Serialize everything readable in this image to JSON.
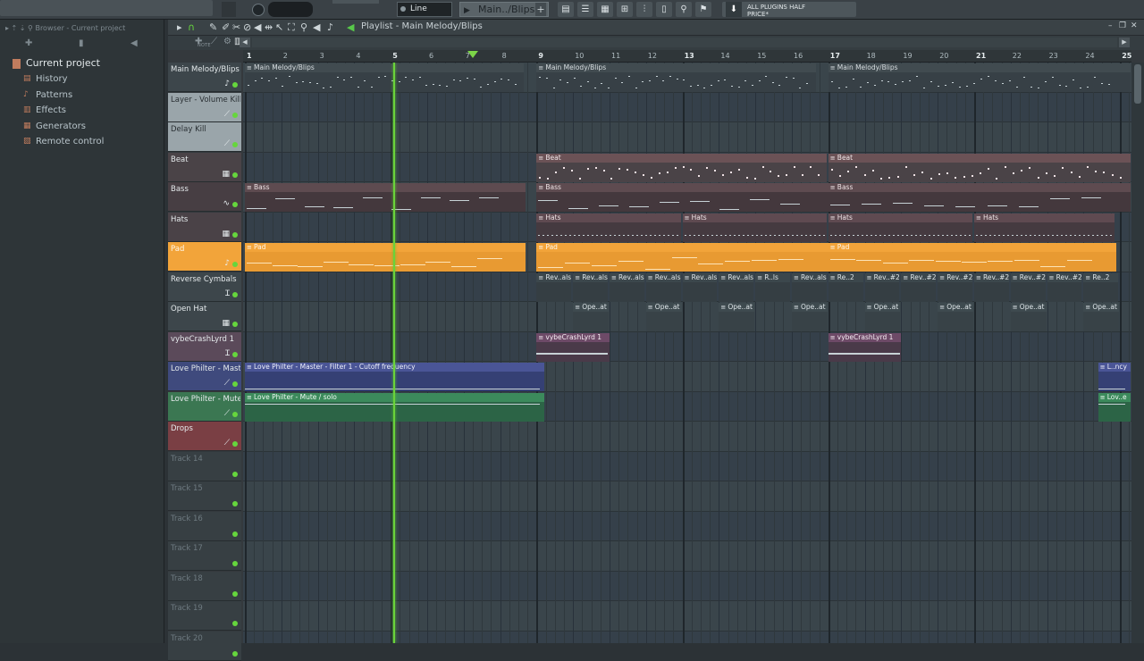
{
  "toolbar": {
    "line_mode": "Line",
    "pattern_name": "Main../Blips",
    "news_text_1": "ALL PLUGINS HALF",
    "news_text_2": "PRICE*"
  },
  "browser": {
    "title": "Browser - Current project",
    "root": "Current project",
    "items": [
      "History",
      "Patterns",
      "Effects",
      "Generators",
      "Remote control"
    ]
  },
  "playlist": {
    "title": "Playlist - Main Melody/Blips",
    "tools_label": "NOTE",
    "bars": [
      "1",
      "2",
      "3",
      "4",
      "5",
      "6",
      "7",
      "8",
      "9",
      "10",
      "11",
      "12",
      "13",
      "14",
      "15",
      "16",
      "17",
      "18",
      "19",
      "20",
      "21",
      "22",
      "23",
      "24",
      "25"
    ],
    "tracks": [
      {
        "name": "Main Melody/Blips",
        "icon": "note-icon"
      },
      {
        "name": "Layer - Volume Kill",
        "icon": "automation-icon"
      },
      {
        "name": "Delay Kill",
        "icon": "automation-icon"
      },
      {
        "name": "Beat",
        "icon": "pattern-icon"
      },
      {
        "name": "Bass",
        "icon": "automation-wave-icon"
      },
      {
        "name": "Hats",
        "icon": "pattern-icon"
      },
      {
        "name": "Pad",
        "icon": "note-icon"
      },
      {
        "name": "Reverse Cymbals",
        "icon": "audio-icon"
      },
      {
        "name": "Open Hat",
        "icon": "pattern-icon"
      },
      {
        "name": "vybeCrashLyrd 1",
        "icon": "audio-icon"
      },
      {
        "name": "Love Philter - Mast..",
        "icon": "automation-icon"
      },
      {
        "name": "Love Philter - Mute..",
        "icon": "automation-icon"
      },
      {
        "name": "Drops",
        "icon": "automation-icon"
      },
      {
        "name": "Track 14"
      },
      {
        "name": "Track 15"
      },
      {
        "name": "Track 16"
      },
      {
        "name": "Track 17"
      },
      {
        "name": "Track 18"
      },
      {
        "name": "Track 19"
      },
      {
        "name": "Track 20"
      }
    ],
    "clips": {
      "melody": "Main Melody/Blips",
      "beat": "Beat",
      "bass": "Bass",
      "hats": "Hats",
      "pad": "Pad",
      "rev": "Rev..als",
      "rev_b": "R..ls",
      "rev2": "Rev..#2",
      "rev2_b": "Re..2",
      "open": "Ope..at",
      "crash": "vybeCrashLyrd 1",
      "auto1": "Love Philter - Master - Filter 1 - Cutoff frequency",
      "auto1_short": "L..ncy",
      "auto2": "Love Philter - Mute / solo",
      "auto2_short": "Lov..e"
    }
  },
  "colors": {
    "accent_green": "#6ad33a",
    "pad_orange": "#f2a43a",
    "automation_blue": "#4a5596",
    "automation_green": "#3c8a5c"
  }
}
